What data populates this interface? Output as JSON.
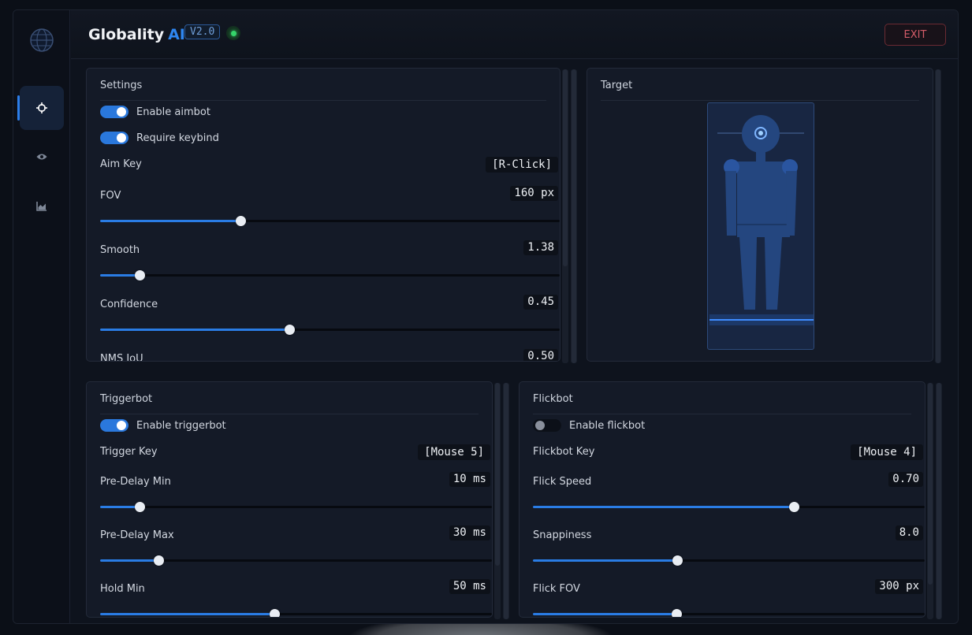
{
  "app": {
    "brand_main": "Globality",
    "brand_ai": "AI",
    "version": "V2.0",
    "status": "online",
    "exit_label": "EXIT"
  },
  "sidebar": {
    "items": [
      {
        "icon": "crosshair-icon",
        "active": true
      },
      {
        "icon": "eye-icon",
        "active": false
      },
      {
        "icon": "chart-icon",
        "active": false
      }
    ]
  },
  "settings": {
    "title": "Settings",
    "enable_aimbot": {
      "label": "Enable aimbot",
      "on": true
    },
    "require_keybind": {
      "label": "Require keybind",
      "on": true
    },
    "aim_key": {
      "label": "Aim Key",
      "value": "[R-Click]"
    },
    "fov": {
      "label": "FOV",
      "value": "160 px",
      "fraction": 0.305
    },
    "smooth": {
      "label": "Smooth",
      "value": "1.38",
      "fraction": 0.086
    },
    "confidence": {
      "label": "Confidence",
      "value": "0.45",
      "fraction": 0.412
    },
    "nms_iou": {
      "label": "NMS IoU",
      "value": "0.50"
    }
  },
  "target": {
    "title": "Target"
  },
  "triggerbot": {
    "title": "Triggerbot",
    "enable": {
      "label": "Enable triggerbot",
      "on": true
    },
    "trigger_key": {
      "label": "Trigger Key",
      "value": "[Mouse 5]"
    },
    "pre_delay_min": {
      "label": "Pre-Delay Min",
      "value": "10 ms",
      "fraction": 0.1
    },
    "pre_delay_max": {
      "label": "Pre-Delay Max",
      "value": "30 ms",
      "fraction": 0.149
    },
    "hold_min": {
      "label": "Hold Min",
      "value": "50 ms",
      "fraction": 0.444
    }
  },
  "flickbot": {
    "title": "Flickbot",
    "enable": {
      "label": "Enable flickbot",
      "on": false
    },
    "flick_key": {
      "label": "Flickbot Key",
      "value": "[Mouse 4]"
    },
    "flick_speed": {
      "label": "Flick Speed",
      "value": "0.70",
      "fraction": 0.667
    },
    "snappiness": {
      "label": "Snappiness",
      "value": "8.0",
      "fraction": 0.368
    },
    "flick_fov": {
      "label": "Flick FOV",
      "value": "300 px",
      "fraction": 0.366
    }
  },
  "colors": {
    "accent": "#2a7ce4",
    "status_green": "#35d46a",
    "exit_red": "#d35c68"
  }
}
